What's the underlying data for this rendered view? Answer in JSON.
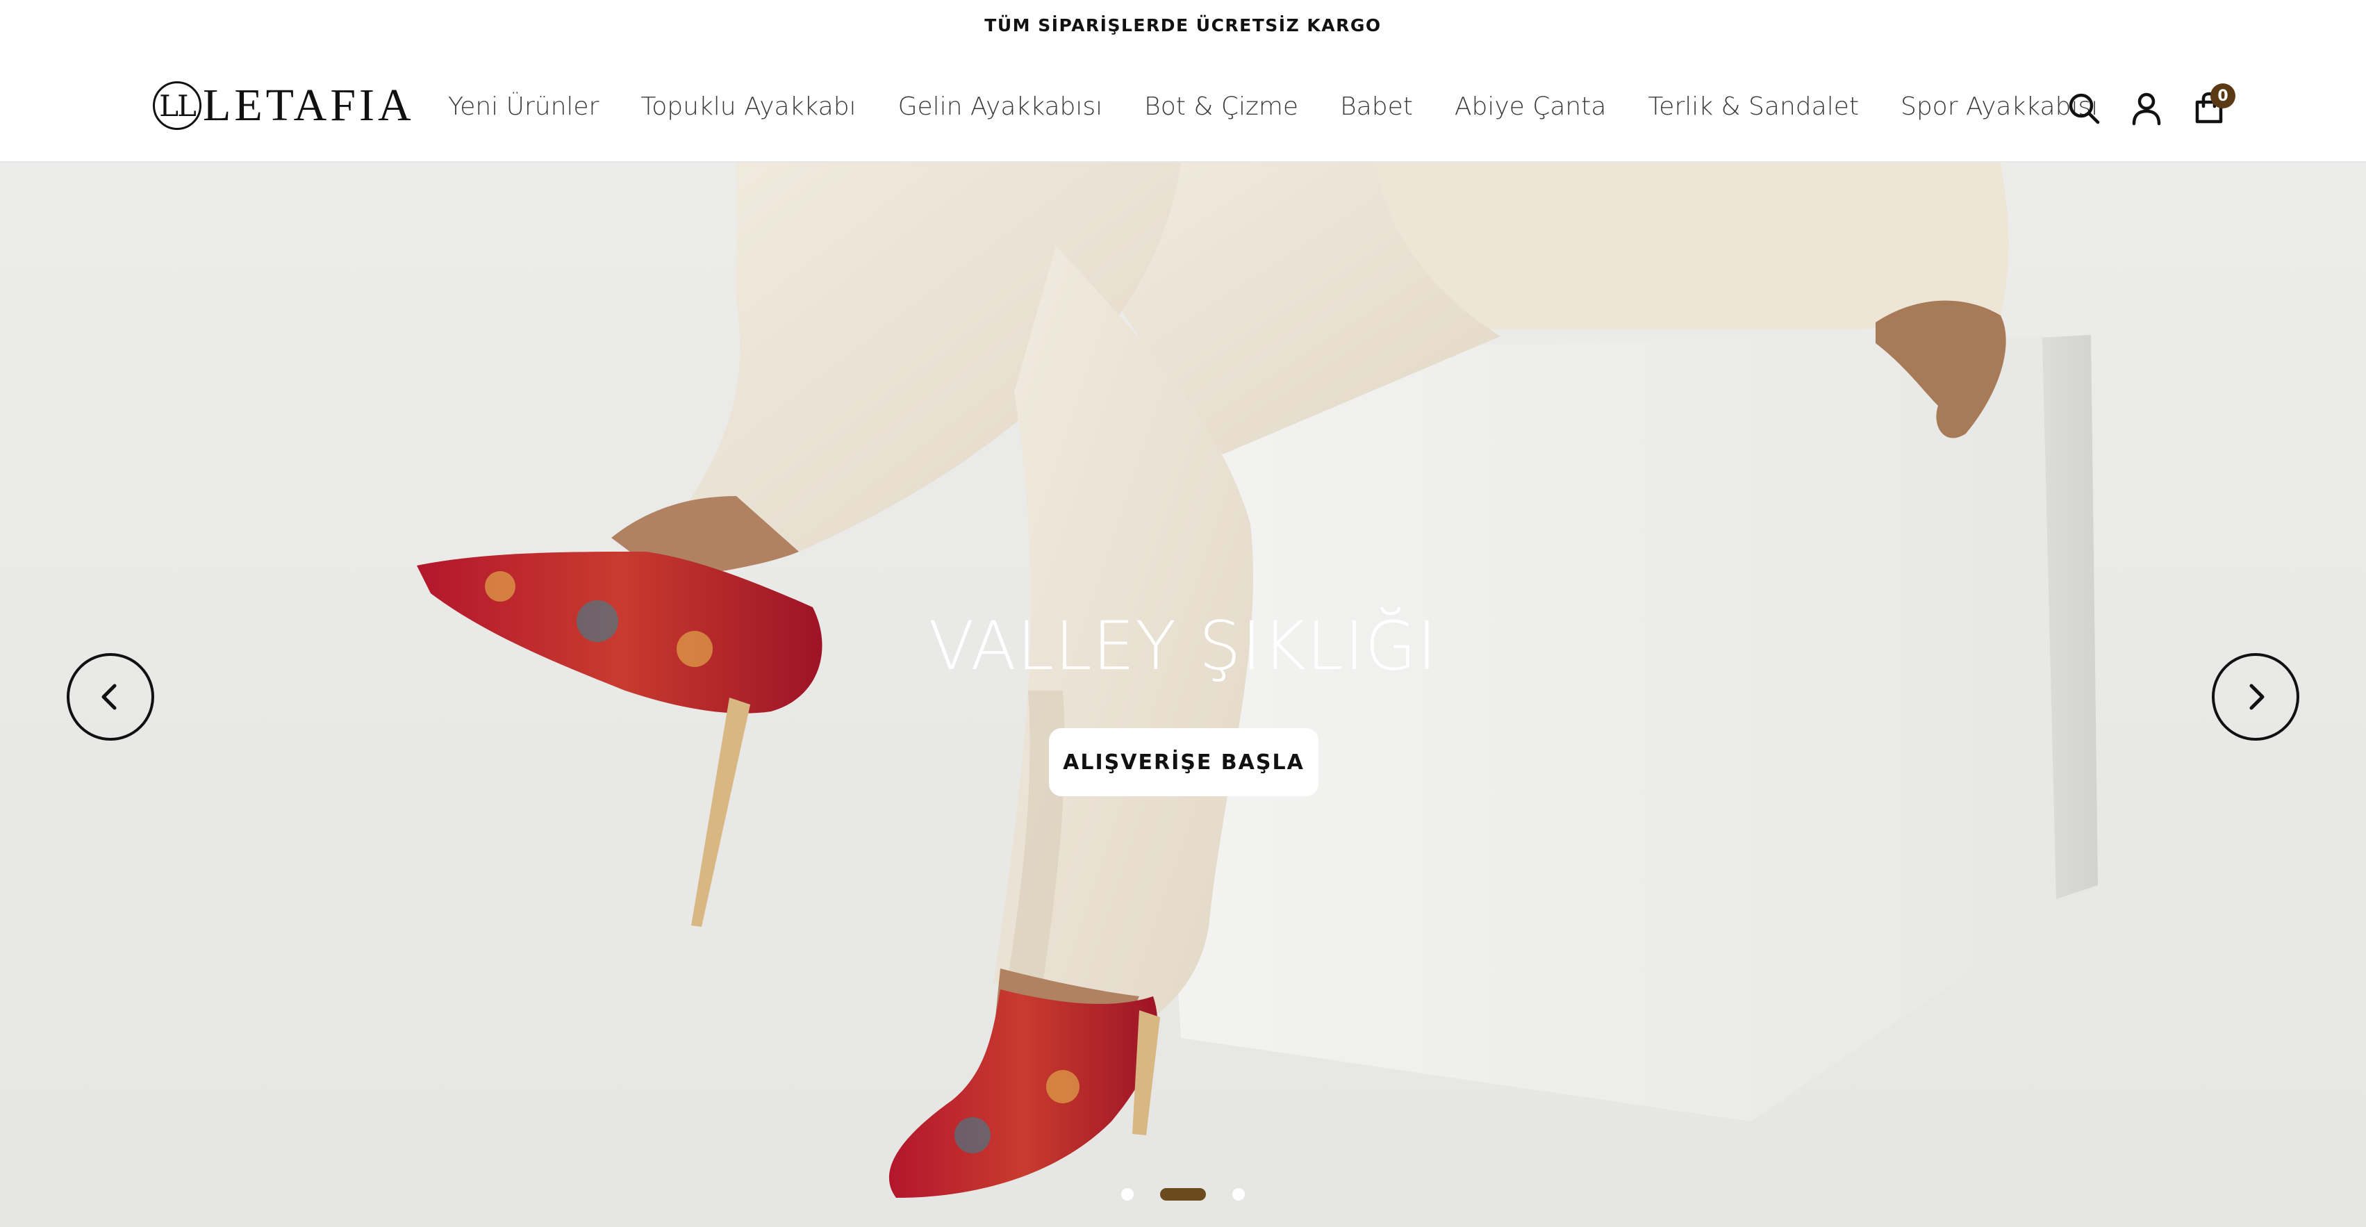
{
  "announcement": {
    "text": "TÜM SİPARİŞLERDE ÜCRETSİZ KARGO"
  },
  "header": {
    "logo_text": "LETAFIA",
    "nav": [
      {
        "label": "Yeni Ürünler"
      },
      {
        "label": "Topuklu Ayakkabı"
      },
      {
        "label": "Gelin Ayakkabısı"
      },
      {
        "label": "Bot & Çizme"
      },
      {
        "label": "Babet"
      },
      {
        "label": "Abiye Çanta"
      },
      {
        "label": "Terlik & Sandalet"
      },
      {
        "label": "Spor Ayakkabısı"
      }
    ],
    "icons": {
      "search": "search-icon",
      "account": "user-icon",
      "cart": "shopping-bag-icon"
    },
    "cart_count": "0"
  },
  "hero": {
    "title": "VALLEY ŞIKLIĞI",
    "cta_label": "ALIŞVERİŞE BAŞLA",
    "slide_count": 3,
    "active_slide": 2
  },
  "colors": {
    "accent": "#6b4a1e",
    "badge": "#5a3a14",
    "text": "#1a1a1a"
  }
}
